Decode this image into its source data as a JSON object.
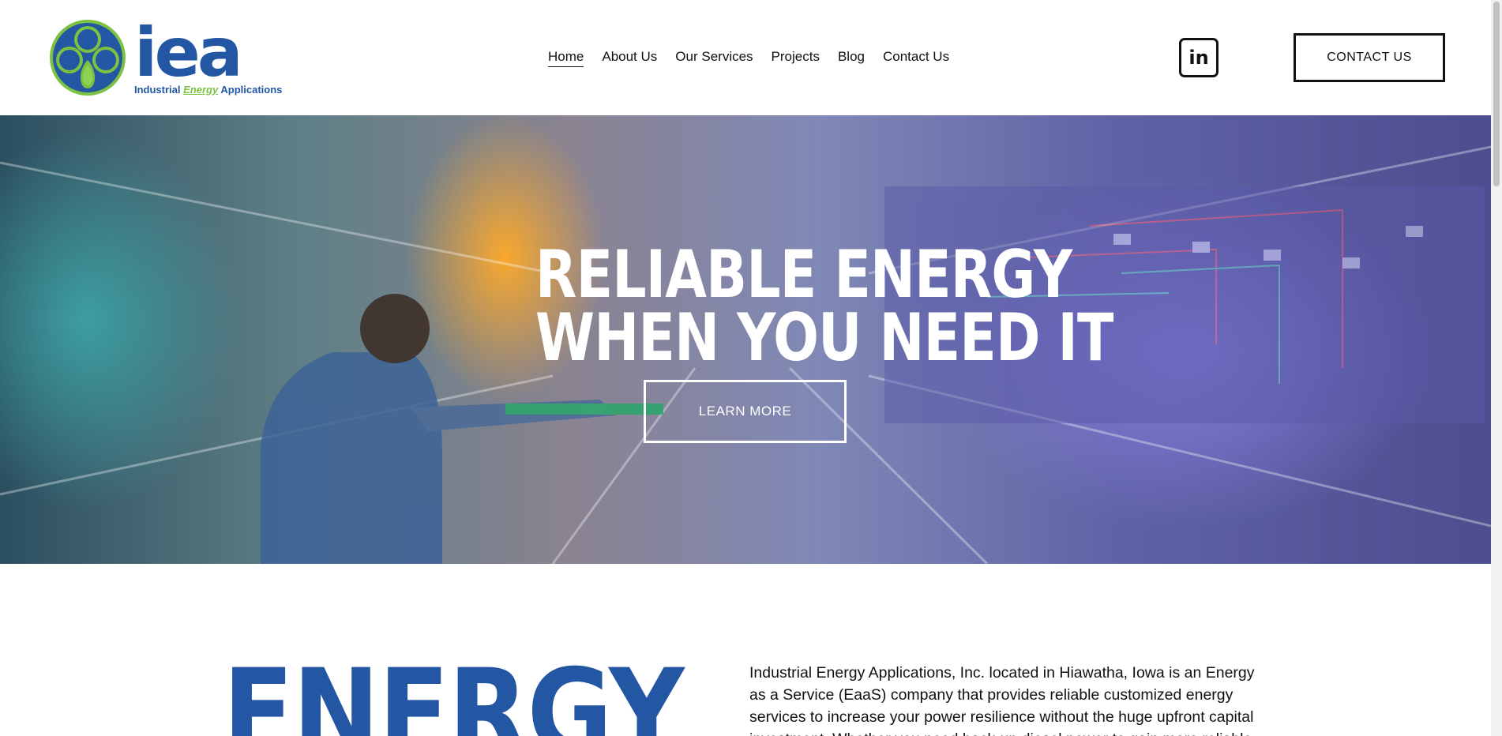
{
  "brand": {
    "letters": "iea",
    "tagline_prefix": "Industrial",
    "tagline_accent": "Energy",
    "tagline_suffix": "Applications",
    "colors": {
      "primary": "#2356a3",
      "accent": "#7cc242"
    }
  },
  "nav": {
    "items": [
      {
        "label": "Home",
        "active": true
      },
      {
        "label": "About Us",
        "active": false
      },
      {
        "label": "Our Services",
        "active": false
      },
      {
        "label": "Projects",
        "active": false
      },
      {
        "label": "Blog",
        "active": false
      },
      {
        "label": "Contact Us",
        "active": false
      }
    ]
  },
  "header": {
    "linkedin_icon": "linkedin-icon",
    "linkedin_text": "in",
    "cta_label": "CONTACT US"
  },
  "hero": {
    "title_line1": "RELIABLE ENERGY",
    "title_line2": "WHEN YOU NEED IT",
    "button_label": "LEARN MORE"
  },
  "intro": {
    "heading": "ENERGY",
    "paragraph": "Industrial Energy Applications, Inc. located in Hiawatha, Iowa is an Energy as a Service (EaaS) company that provides reliable customized energy services to increase your power resilience without the huge upfront capital investment. Whether you need back-up diesel power to gain more reliable"
  }
}
